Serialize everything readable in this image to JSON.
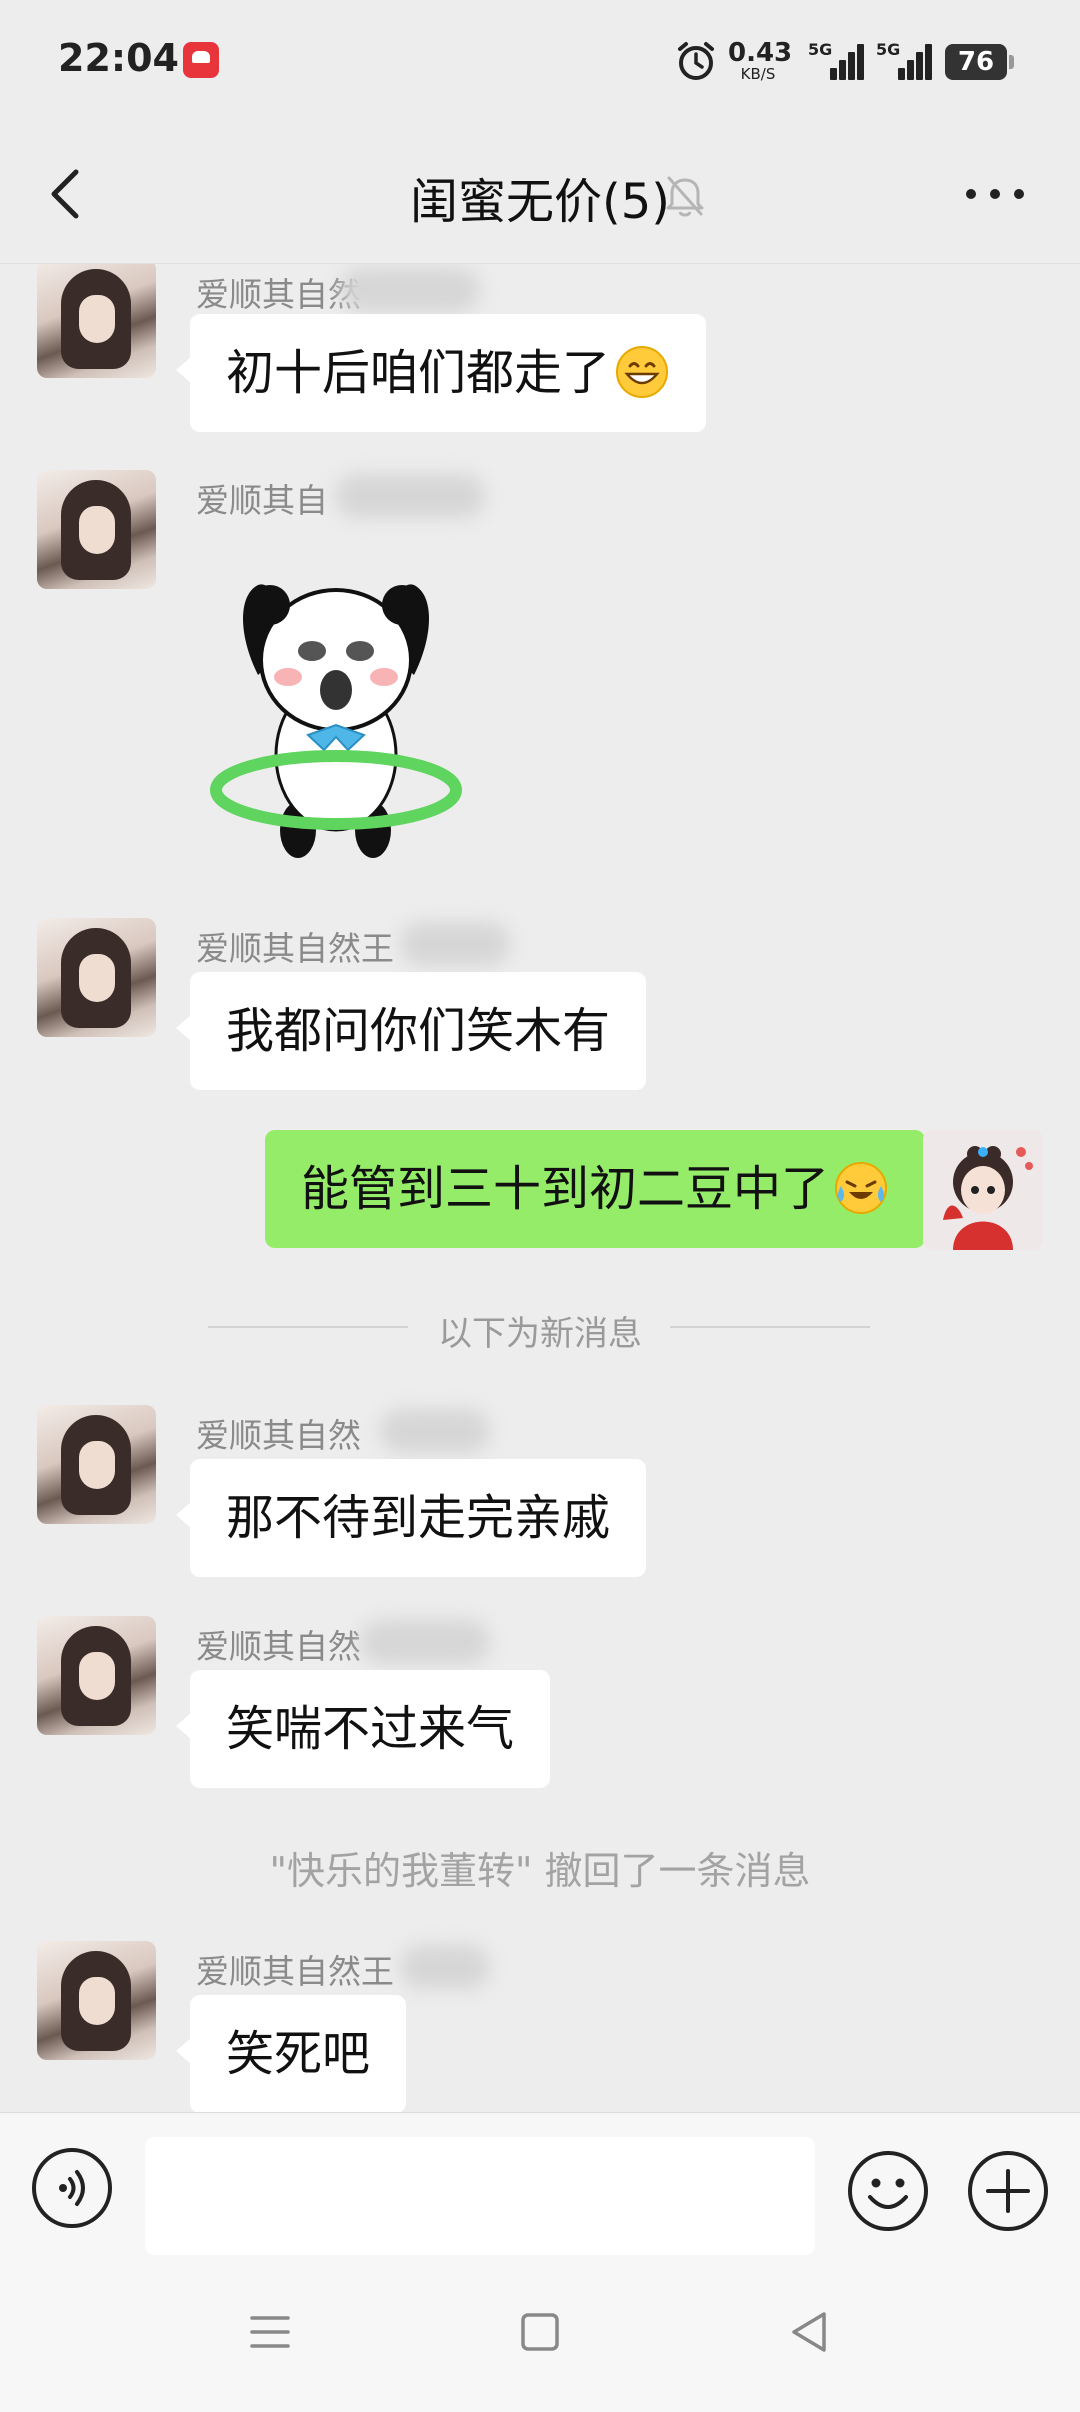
{
  "status_bar": {
    "time": "22:04",
    "net_speed_value": "0.43",
    "net_speed_unit": "KB/S",
    "signal1_label": "5G",
    "signal2_label": "5G",
    "battery": "76"
  },
  "header": {
    "title": "闺蜜无价(5)"
  },
  "messages": {
    "m1": {
      "sender": "爱顺其自然",
      "text": "初十后咱们都走了"
    },
    "m2": {
      "sender": "爱顺其自"
    },
    "m3": {
      "sender": "爱顺其自然王",
      "text": "我都问你们笑木有"
    },
    "m4": {
      "text": "能管到三十到初二豆中了"
    },
    "divider": "以下为新消息",
    "m5": {
      "sender": "爱顺其自然",
      "text": "那不待到走完亲戚"
    },
    "m6": {
      "sender": "爱顺其自然",
      "text": "笑喘不过来气"
    },
    "recall": "\"快乐的我董转\" 撤回了一条消息",
    "m7": {
      "sender": "爱顺其自然王",
      "text": "笑死吧"
    }
  },
  "input_bar": {
    "value": ""
  },
  "colors": {
    "background": "#ededed",
    "self_bubble": "#95ec69",
    "other_bubble": "#ffffff"
  },
  "icons": [
    "back-arrow-icon",
    "mute-bell-icon",
    "more-icon",
    "voice-icon",
    "emoji-icon",
    "plus-icon",
    "menu-icon",
    "home-icon",
    "back-triangle-icon"
  ]
}
